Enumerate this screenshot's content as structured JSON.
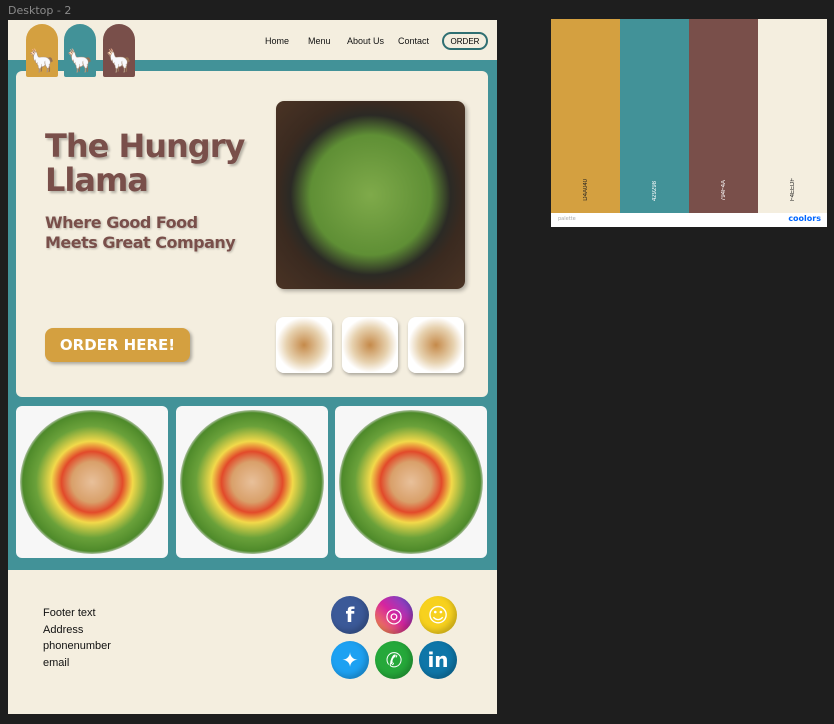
{
  "frame": {
    "label": "Desktop - 2"
  },
  "colors": {
    "gold": "#D4A040",
    "teal": "#429298",
    "brown": "#794F4A",
    "cream": "#F4EEDF"
  },
  "nav": {
    "items": [
      "Home",
      "Menu",
      "About Us",
      "Contact"
    ],
    "order": "ORDER"
  },
  "hero": {
    "title_line1": "The Hungry",
    "title_line2": "Llama",
    "subtitle_line1": "Where Good Food",
    "subtitle_line2": "Meets Great Company",
    "cta": "ORDER HERE!"
  },
  "footer": {
    "lines": [
      "Footer text",
      "Address",
      "phonenumber",
      "email"
    ],
    "social": [
      "facebook",
      "instagram",
      "snapchat",
      "twitter",
      "whatsapp",
      "linkedin"
    ]
  },
  "palette": {
    "swatches": [
      "D4A040",
      "429298",
      "794F4A",
      "F4EEDF"
    ],
    "label": "palette",
    "brand": "coolors"
  }
}
